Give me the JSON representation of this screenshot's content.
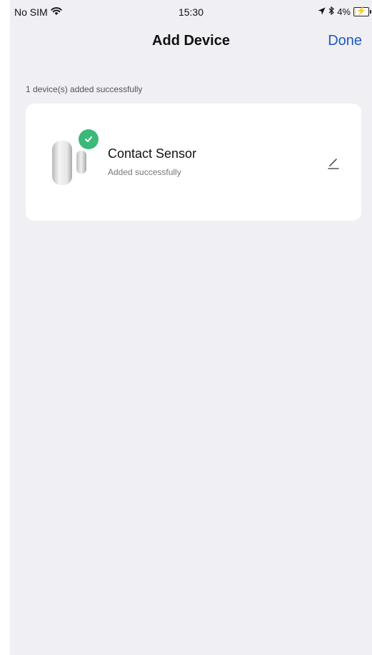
{
  "status_bar": {
    "carrier": "No SIM",
    "time": "15:30",
    "battery_text": "4%",
    "battery_level": 0.04,
    "icons": [
      "wifi-icon",
      "location-arrow-icon",
      "bluetooth-icon",
      "battery-charging-icon"
    ]
  },
  "nav": {
    "title": "Add Device",
    "done_label": "Done"
  },
  "summary": {
    "label": "1 device(s) added successfully"
  },
  "devices": [
    {
      "name": "Contact Sensor",
      "status": "Added successfully",
      "icons": [
        "contact-sensor-icon",
        "check-icon",
        "edit-icon"
      ]
    }
  ],
  "colors": {
    "accent": "#1c5ac0",
    "success": "#3cb878",
    "background": "#efeff4",
    "card": "#ffffff"
  }
}
